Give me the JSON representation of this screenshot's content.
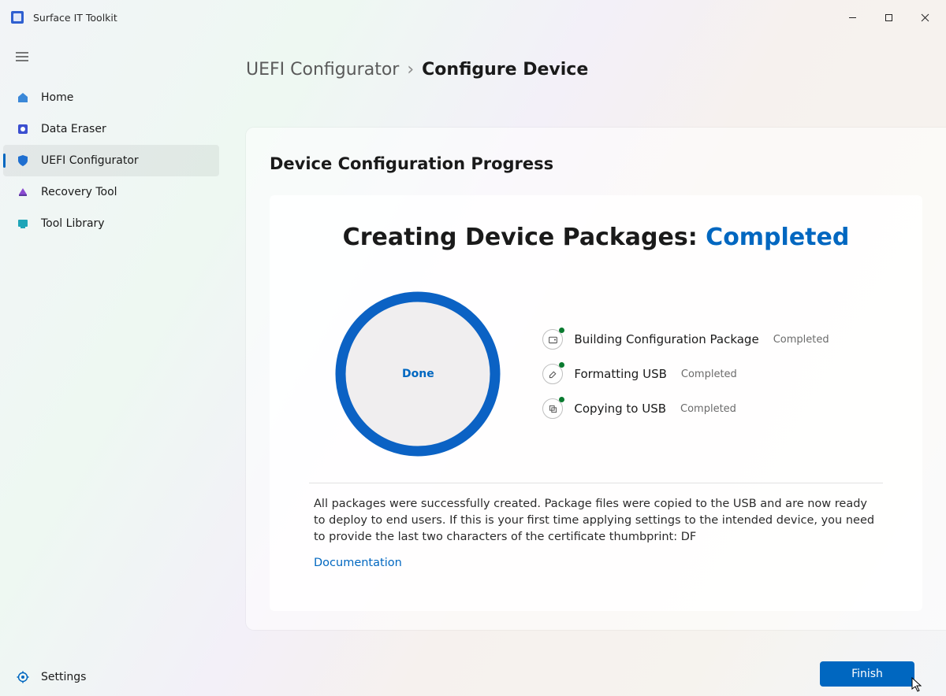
{
  "app": {
    "title": "Surface IT Toolkit"
  },
  "sidebar": {
    "items": [
      {
        "label": "Home"
      },
      {
        "label": "Data Eraser"
      },
      {
        "label": "UEFI Configurator"
      },
      {
        "label": "Recovery Tool"
      },
      {
        "label": "Tool Library"
      }
    ],
    "active_index": 2,
    "settings_label": "Settings"
  },
  "breadcrumb": {
    "parent": "UEFI Configurator",
    "current": "Configure Device"
  },
  "page": {
    "heading": "Device Configuration Progress",
    "status_prefix": "Creating Device Packages:",
    "status_value": "Completed",
    "ring_label": "Done",
    "steps": [
      {
        "label": "Building Configuration Package",
        "status": "Completed",
        "icon": "package-icon"
      },
      {
        "label": "Formatting USB",
        "status": "Completed",
        "icon": "eraser-icon"
      },
      {
        "label": "Copying to USB",
        "status": "Completed",
        "icon": "copy-icon"
      }
    ],
    "summary": "All packages were successfully created. Package files were copied to the USB and are now ready to deploy to end users. If this is your first time applying settings to the intended device, you need to provide the last two characters of the certificate thumbprint: DF",
    "doc_link": "Documentation",
    "finish_label": "Finish"
  },
  "colors": {
    "accent": "#0067c0"
  }
}
